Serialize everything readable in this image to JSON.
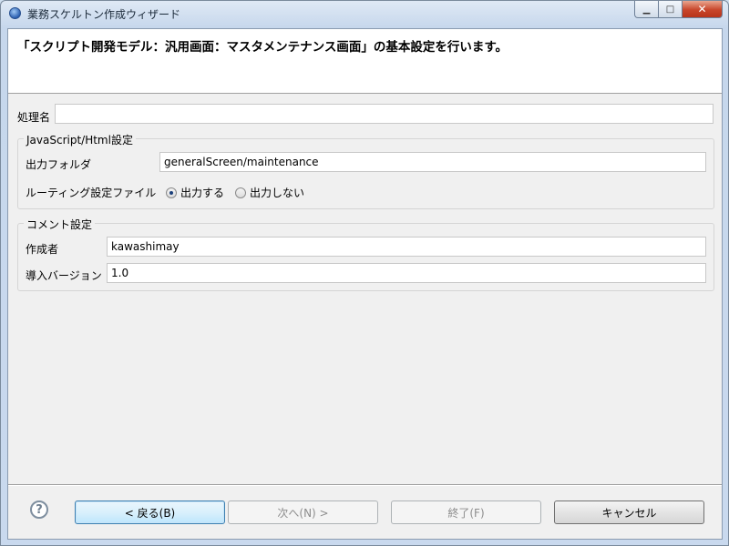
{
  "window": {
    "title": "業務スケルトン作成ウィザード"
  },
  "header": {
    "title": "「スクリプト開発モデル：汎用画面：マスタメンテナンス画面」の基本設定を行います。"
  },
  "form": {
    "process_name_label": "処理名",
    "process_name_value": "",
    "js_group": {
      "title": "JavaScript/Html設定",
      "output_folder_label": "出力フォルダ",
      "output_folder_value": "generalScreen/maintenance",
      "routing_label": "ルーティング設定ファイル",
      "routing_options": [
        {
          "label": "出力する",
          "checked": true
        },
        {
          "label": "出力しない",
          "checked": false
        }
      ]
    },
    "comment_group": {
      "title": "コメント設定",
      "author_label": "作成者",
      "author_value": "kawashimay",
      "version_label": "導入バージョン",
      "version_value": "1.0"
    }
  },
  "footer": {
    "help_icon": "help-icon",
    "back_label": "< 戻る(B)",
    "next_label": "次へ(N) >",
    "finish_label": "終了(F)",
    "cancel_label": "キャンセル"
  }
}
